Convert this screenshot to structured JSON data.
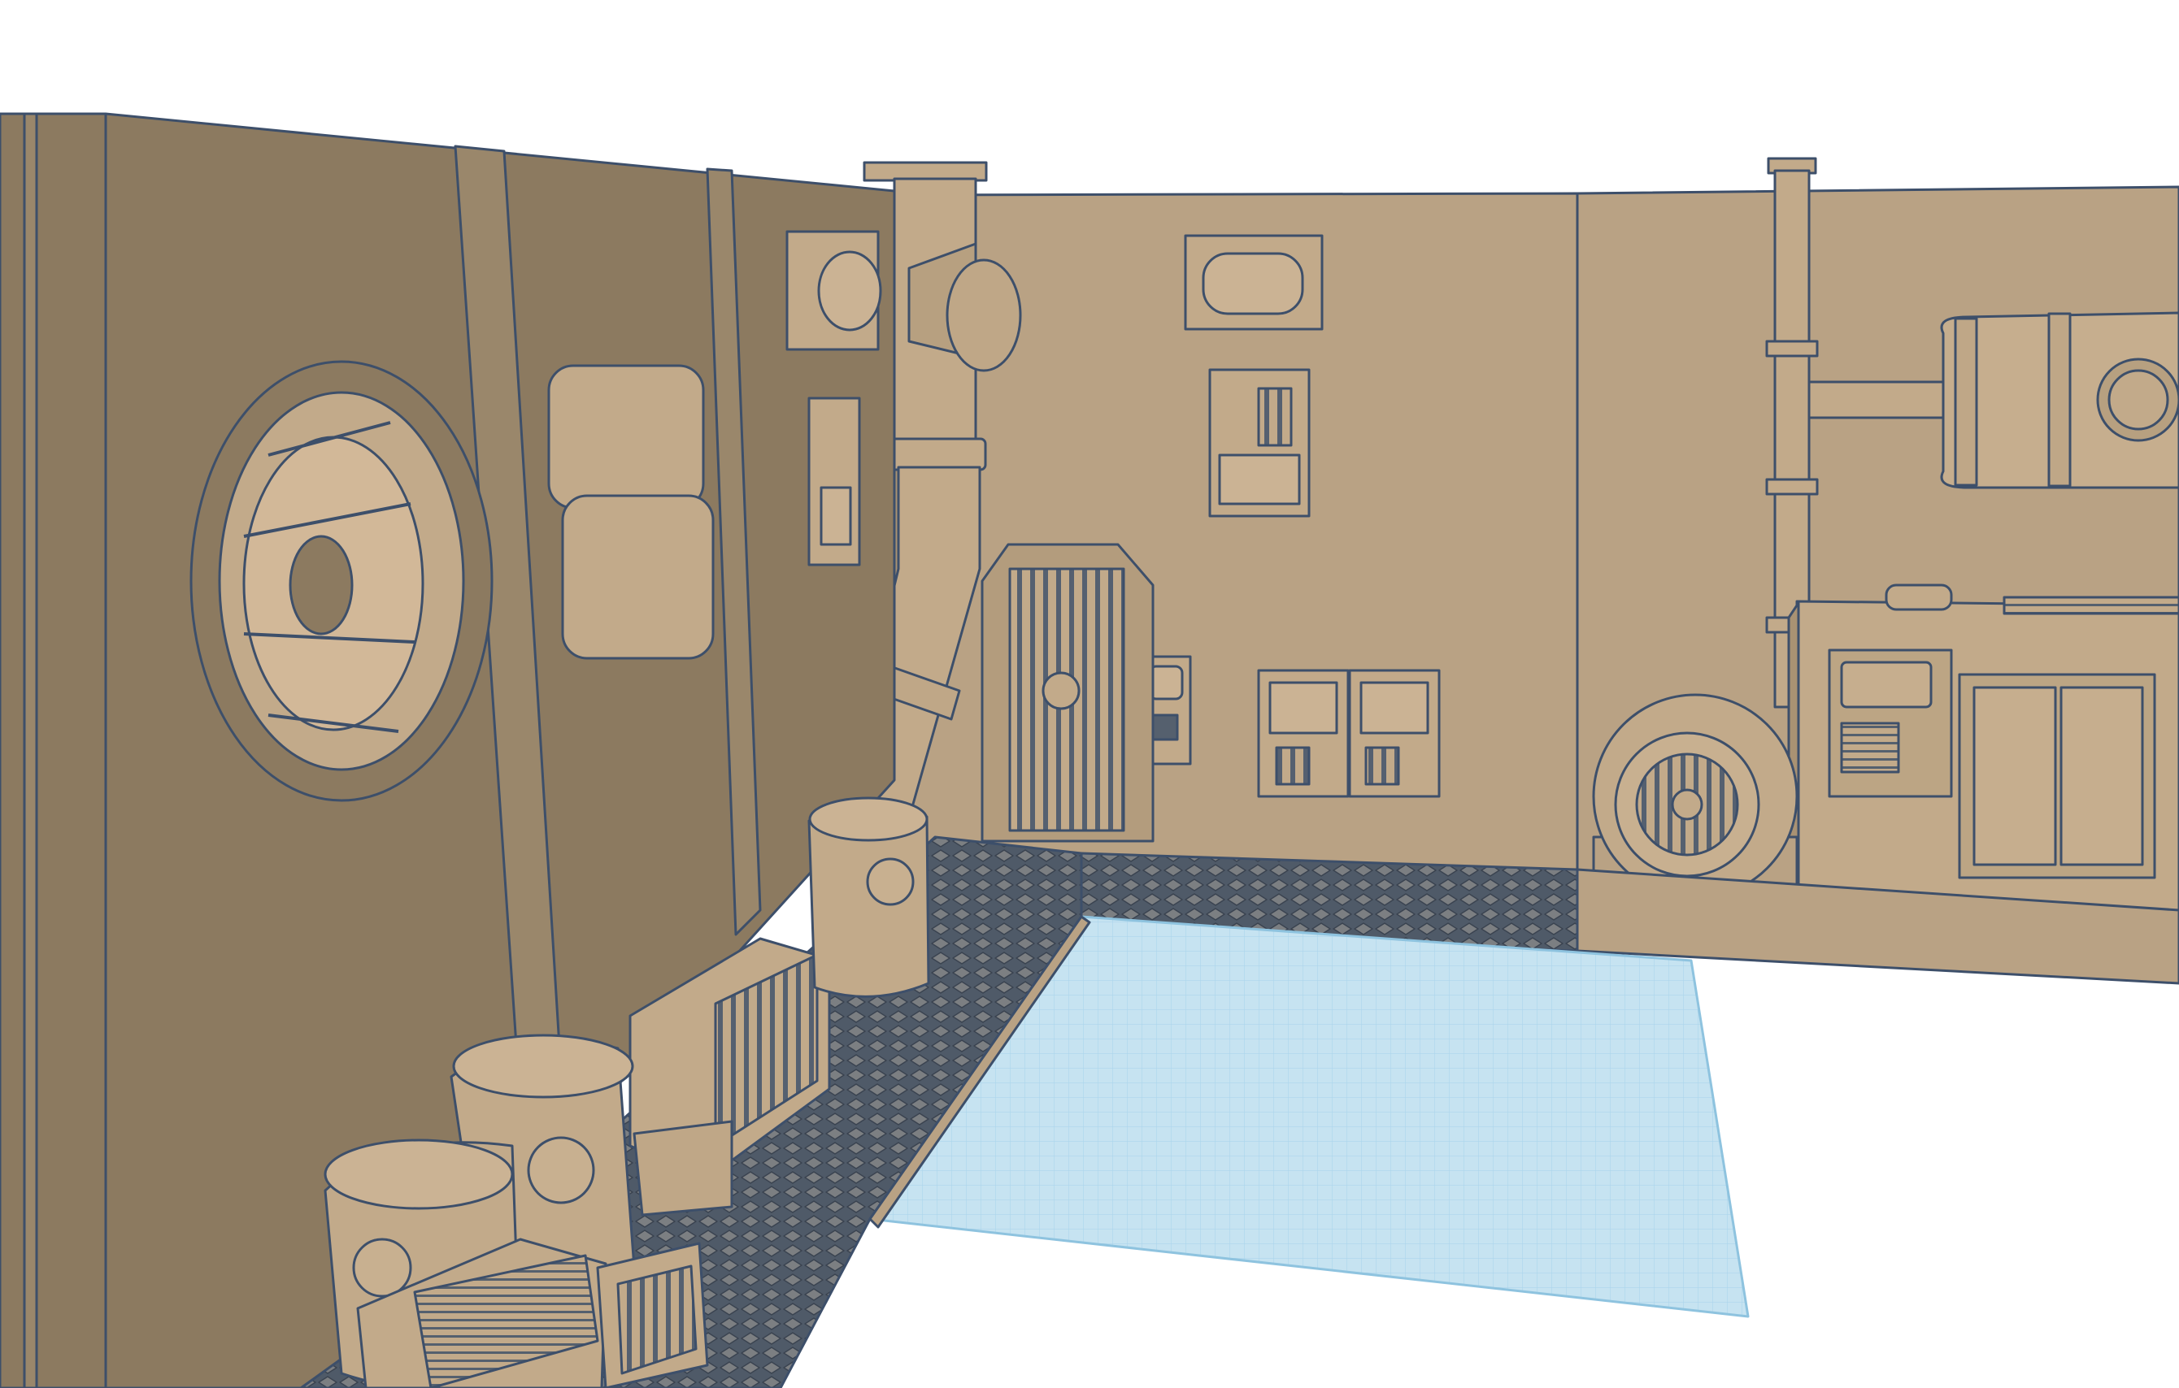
{
  "viewport": {
    "background": "#ffffff",
    "outline_color": "#3d4f6a",
    "colors": {
      "wall_left": "#8c7a60",
      "wall_left_dark": "#7e6d55",
      "wall_back": "#b9a284",
      "wall_back_light": "#c2ab8b",
      "floor_tile": "#55606e",
      "workplane": "#c6e3f1",
      "workplane_grid": "#8ec3df",
      "prop": "#c2aa8a"
    },
    "workplane": {
      "grid_visible": true
    },
    "scene_objects": [
      "left-wall",
      "back-wall",
      "right-wall",
      "gear-vent",
      "padded-panels",
      "vertical-pipe",
      "bent-pipe",
      "riveted-door",
      "wall-lamp",
      "control-panels",
      "oil-drums",
      "generator-crate",
      "ventilation-fan",
      "machine-console",
      "cylindrical-tank",
      "diamond-plate-floor"
    ]
  }
}
